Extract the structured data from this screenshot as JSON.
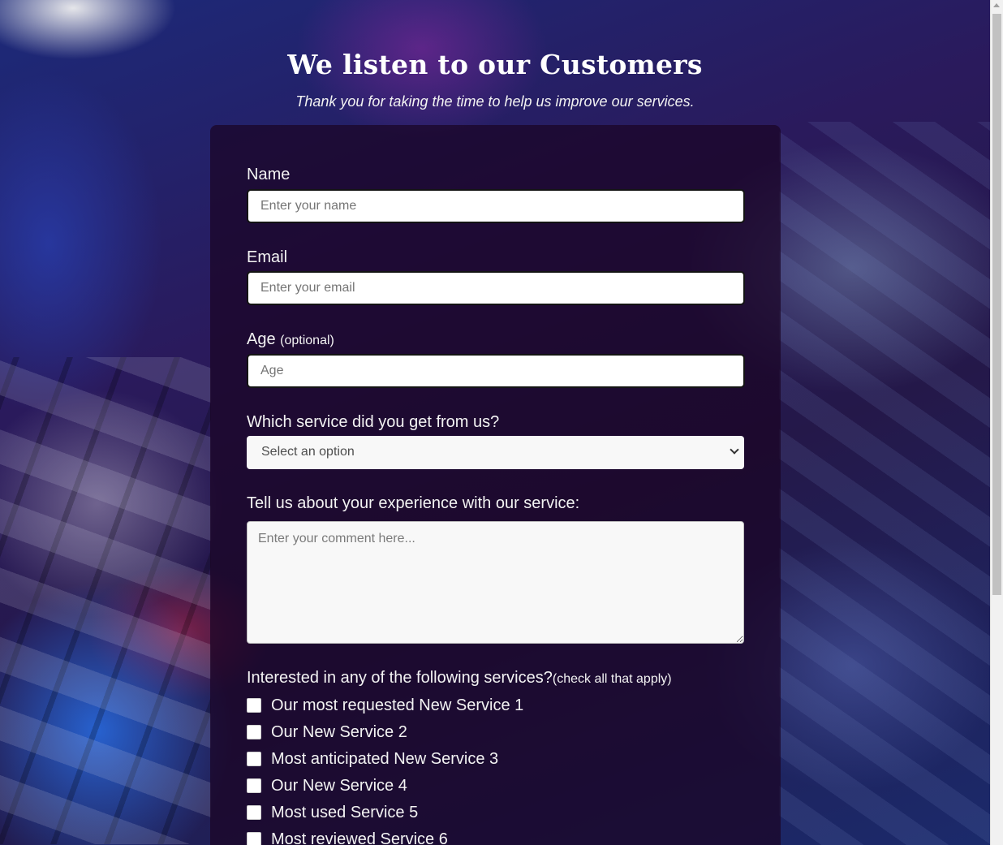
{
  "header": {
    "title": "We listen to our Customers",
    "subtitle": "Thank you for taking the time to help us improve our services."
  },
  "form": {
    "name": {
      "label": "Name",
      "placeholder": "Enter your name",
      "value": ""
    },
    "email": {
      "label": "Email",
      "placeholder": "Enter your email",
      "value": ""
    },
    "age": {
      "label": "Age",
      "optional": "(optional)",
      "placeholder": "Age",
      "value": ""
    },
    "service": {
      "label": "Which service did you get from us?",
      "selected": "Select an option"
    },
    "comment": {
      "label": "Tell us about your experience with our service:",
      "placeholder": "Enter your comment here...",
      "value": ""
    },
    "interests": {
      "label": "Interested in any of the following services?",
      "hint": "(check all that apply)",
      "options": [
        {
          "label": "Our most requested New Service 1",
          "checked": false
        },
        {
          "label": "Our New Service 2",
          "checked": false
        },
        {
          "label": "Most anticipated New Service 3",
          "checked": false
        },
        {
          "label": "Our New Service 4",
          "checked": false
        },
        {
          "label": "Most used Service 5",
          "checked": false
        },
        {
          "label": "Most reviewed Service 6",
          "checked": false
        }
      ]
    }
  },
  "colors": {
    "card_background": "#1a0424",
    "label_text": "#f3f3f3",
    "input_background": "#ffffff"
  },
  "icons": {
    "select_arrow": "chevron-down-icon",
    "scroll_up": "triangle-up-icon"
  }
}
